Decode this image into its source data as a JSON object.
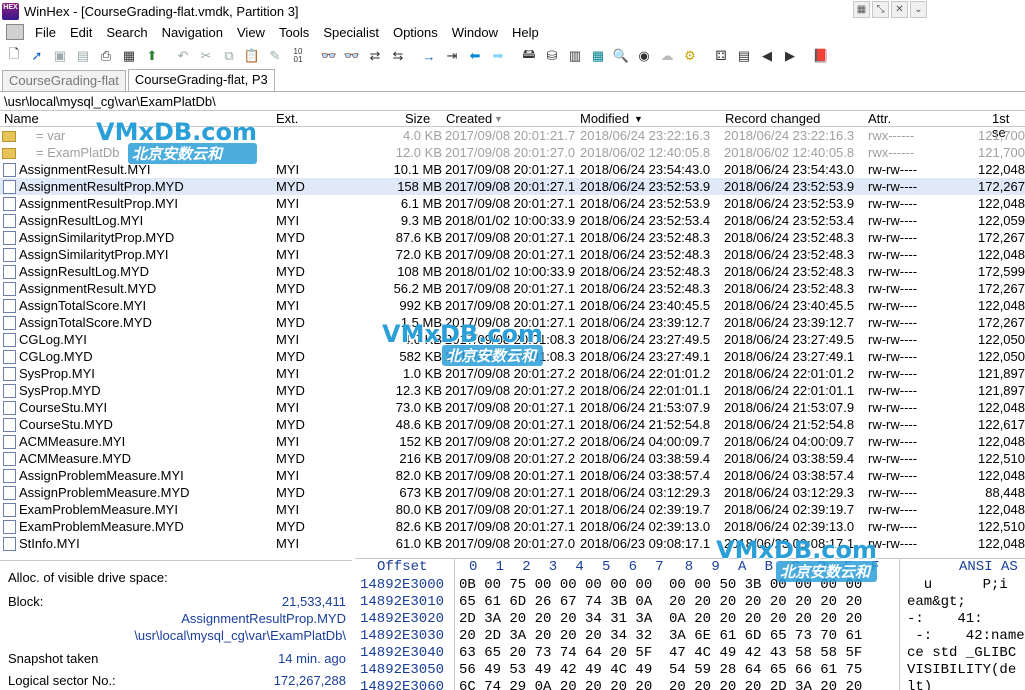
{
  "window": {
    "title": "WinHex - [CourseGrading-flat.vmdk, Partition 3]",
    "logo_text": "HEX"
  },
  "menu": [
    "File",
    "Edit",
    "Search",
    "Navigation",
    "View",
    "Tools",
    "Specialist",
    "Options",
    "Window",
    "Help"
  ],
  "tabs": [
    {
      "label": "CourseGrading-flat"
    },
    {
      "label": "CourseGrading-flat, P3"
    }
  ],
  "path": "\\usr\\local\\mysql_cg\\var\\ExamPlatDb\\",
  "columns": {
    "name": "Name",
    "ext": "Ext.",
    "size": "Size",
    "created": "Created",
    "modified": "Modified",
    "changed": "Record changed",
    "attr": "Attr.",
    "sector": "1st se"
  },
  "files": [
    {
      "name": "=     var",
      "ext": "",
      "size": "4.0 KB",
      "created": "2017/09/08   20:01:21.7",
      "modified": "2018/06/24   23:22:16.3",
      "changed": "2018/06/24   23:22:16.3",
      "attr": "rwx------",
      "sector": "121,700",
      "kind": "folder",
      "dim": true
    },
    {
      "name": "=     ExamPlatDb",
      "ext": "",
      "size": "12.0 KB",
      "created": "2017/09/08   20:01:27.0",
      "modified": "2018/06/02   12:40:05.8",
      "changed": "2018/06/02   12:40:05.8",
      "attr": "rwx------",
      "sector": "121,700",
      "kind": "folder",
      "dim": true
    },
    {
      "name": "AssignmentResult.MYI",
      "ext": "MYI",
      "size": "10.1 MB",
      "created": "2017/09/08   20:01:27.1",
      "modified": "2018/06/24   23:54:43.0",
      "changed": "2018/06/24   23:54:43.0",
      "attr": "rw-rw----",
      "sector": "122,048"
    },
    {
      "name": "AssignmentResultProp.MYD",
      "ext": "MYD",
      "size": "158 MB",
      "created": "2017/09/08   20:01:27.1",
      "modified": "2018/06/24   23:52:53.9",
      "changed": "2018/06/24   23:52:53.9",
      "attr": "rw-rw----",
      "sector": "172,267",
      "selected": true
    },
    {
      "name": "AssignmentResultProp.MYI",
      "ext": "MYI",
      "size": "6.1 MB",
      "created": "2017/09/08   20:01:27.1",
      "modified": "2018/06/24   23:52:53.9",
      "changed": "2018/06/24   23:52:53.9",
      "attr": "rw-rw----",
      "sector": "122,048"
    },
    {
      "name": "AssignResultLog.MYI",
      "ext": "MYI",
      "size": "9.3 MB",
      "created": "2018/01/02   10:00:33.9",
      "modified": "2018/06/24   23:52:53.4",
      "changed": "2018/06/24   23:52:53.4",
      "attr": "rw-rw----",
      "sector": "122,059"
    },
    {
      "name": "AssignSimilaritytProp.MYD",
      "ext": "MYD",
      "size": "87.6 KB",
      "created": "2017/09/08   20:01:27.1",
      "modified": "2018/06/24   23:52:48.3",
      "changed": "2018/06/24   23:52:48.3",
      "attr": "rw-rw----",
      "sector": "172,267"
    },
    {
      "name": "AssignSimilaritytProp.MYI",
      "ext": "MYI",
      "size": "72.0 KB",
      "created": "2017/09/08   20:01:27.1",
      "modified": "2018/06/24   23:52:48.3",
      "changed": "2018/06/24   23:52:48.3",
      "attr": "rw-rw----",
      "sector": "122,048"
    },
    {
      "name": "AssignResultLog.MYD",
      "ext": "MYD",
      "size": "108 MB",
      "created": "2018/01/02   10:00:33.9",
      "modified": "2018/06/24   23:52:48.3",
      "changed": "2018/06/24   23:52:48.3",
      "attr": "rw-rw----",
      "sector": "172,599"
    },
    {
      "name": "AssignmentResult.MYD",
      "ext": "MYD",
      "size": "56.2 MB",
      "created": "2017/09/08   20:01:27.1",
      "modified": "2018/06/24   23:52:48.3",
      "changed": "2018/06/24   23:52:48.3",
      "attr": "rw-rw----",
      "sector": "172,267"
    },
    {
      "name": "AssignTotalScore.MYI",
      "ext": "MYI",
      "size": "992 KB",
      "created": "2017/09/08   20:01:27.1",
      "modified": "2018/06/24   23:40:45.5",
      "changed": "2018/06/24   23:40:45.5",
      "attr": "rw-rw----",
      "sector": "122,048"
    },
    {
      "name": "AssignTotalScore.MYD",
      "ext": "MYD",
      "size": "1.5 MB",
      "created": "2017/09/08   20:01:27.1",
      "modified": "2018/06/24   23:39:12.7",
      "changed": "2018/06/24   23:39:12.7",
      "attr": "rw-rw----",
      "sector": "172,267"
    },
    {
      "name": "CGLog.MYI",
      "ext": "MYI",
      "size": "4.0 KB",
      "created": "2017/09/08   20:01:08.3",
      "modified": "2018/06/24   23:27:49.5",
      "changed": "2018/06/24   23:27:49.5",
      "attr": "rw-rw----",
      "sector": "122,050"
    },
    {
      "name": "CGLog.MYD",
      "ext": "MYD",
      "size": "582 KB",
      "created": "2017/09/08   20:01:08.3",
      "modified": "2018/06/24   23:27:49.1",
      "changed": "2018/06/24   23:27:49.1",
      "attr": "rw-rw----",
      "sector": "122,050"
    },
    {
      "name": "SysProp.MYI",
      "ext": "MYI",
      "size": "1.0 KB",
      "created": "2017/09/08   20:01:27.2",
      "modified": "2018/06/24   22:01:01.2",
      "changed": "2018/06/24   22:01:01.2",
      "attr": "rw-rw----",
      "sector": "121,897"
    },
    {
      "name": "SysProp.MYD",
      "ext": "MYD",
      "size": "12.3 KB",
      "created": "2017/09/08   20:01:27.2",
      "modified": "2018/06/24   22:01:01.1",
      "changed": "2018/06/24   22:01:01.1",
      "attr": "rw-rw----",
      "sector": "121,897"
    },
    {
      "name": "CourseStu.MYI",
      "ext": "MYI",
      "size": "73.0 KB",
      "created": "2017/09/08   20:01:27.1",
      "modified": "2018/06/24   21:53:07.9",
      "changed": "2018/06/24   21:53:07.9",
      "attr": "rw-rw----",
      "sector": "122,048"
    },
    {
      "name": "CourseStu.MYD",
      "ext": "MYD",
      "size": "48.6 KB",
      "created": "2017/09/08   20:01:27.1",
      "modified": "2018/06/24   21:52:54.8",
      "changed": "2018/06/24   21:52:54.8",
      "attr": "rw-rw----",
      "sector": "122,617"
    },
    {
      "name": "ACMMeasure.MYI",
      "ext": "MYI",
      "size": "152 KB",
      "created": "2017/09/08   20:01:27.2",
      "modified": "2018/06/24   04:00:09.7",
      "changed": "2018/06/24   04:00:09.7",
      "attr": "rw-rw----",
      "sector": "122,048"
    },
    {
      "name": "ACMMeasure.MYD",
      "ext": "MYD",
      "size": "216 KB",
      "created": "2017/09/08   20:01:27.2",
      "modified": "2018/06/24   03:38:59.4",
      "changed": "2018/06/24   03:38:59.4",
      "attr": "rw-rw----",
      "sector": "122,510"
    },
    {
      "name": "AssignProblemMeasure.MYI",
      "ext": "MYI",
      "size": "82.0 KB",
      "created": "2017/09/08   20:01:27.1",
      "modified": "2018/06/24   03:38:57.4",
      "changed": "2018/06/24   03:38:57.4",
      "attr": "rw-rw----",
      "sector": "122,048"
    },
    {
      "name": "AssignProblemMeasure.MYD",
      "ext": "MYD",
      "size": "673 KB",
      "created": "2017/09/08   20:01:27.1",
      "modified": "2018/06/24   03:12:29.3",
      "changed": "2018/06/24   03:12:29.3",
      "attr": "rw-rw----",
      "sector": "88,448"
    },
    {
      "name": "ExamProblemMeasure.MYI",
      "ext": "MYI",
      "size": "80.0 KB",
      "created": "2017/09/08   20:01:27.1",
      "modified": "2018/06/24   02:39:19.7",
      "changed": "2018/06/24   02:39:19.7",
      "attr": "rw-rw----",
      "sector": "122,048"
    },
    {
      "name": "ExamProblemMeasure.MYD",
      "ext": "MYD",
      "size": "82.6 KB",
      "created": "2017/09/08   20:01:27.1",
      "modified": "2018/06/24   02:39:13.0",
      "changed": "2018/06/24   02:39:13.0",
      "attr": "rw-rw----",
      "sector": "122,510"
    },
    {
      "name": "StInfo.MYI",
      "ext": "MYI",
      "size": "61.0 KB",
      "created": "2017/09/08   20:01:27.0",
      "modified": "2018/06/23   09:08:17.1",
      "changed": "2018/06/23   09:08:17.1",
      "attr": "rw-rw----",
      "sector": "122,048"
    }
  ],
  "info": {
    "alloc_label": "Alloc. of visible drive space:",
    "block_label": "Block:",
    "block_value": "21,533,411",
    "selected_file": "AssignmentResultProp.MYD",
    "selected_path": "\\usr\\local\\mysql_cg\\var\\ExamPlatDb\\",
    "snapshot_label": "Snapshot taken",
    "snapshot_value": "14 min. ago",
    "sector_label": "Logical sector No.:",
    "sector_value": "172,267,288"
  },
  "hex": {
    "offset_label": "Offset",
    "columns": [
      "0",
      "1",
      "2",
      "3",
      "4",
      "5",
      "6",
      "7",
      "8",
      "9",
      "A",
      "B",
      "C",
      "D",
      "E",
      "F"
    ],
    "ascii_label": "ANSI AS",
    "rows": [
      {
        "offset": "14892E3000",
        "bytes": "0B 00 75 00 00 00 00 00  00 00 50 3B 00 00 00 00",
        "ascii": "  u      P;i"
      },
      {
        "offset": "14892E3010",
        "bytes": "65 61 6D 26 67 74 3B 0A  20 20 20 20 20 20 20 20",
        "ascii": "eam&gt;"
      },
      {
        "offset": "14892E3020",
        "bytes": "2D 3A 20 20 20 34 31 3A  0A 20 20 20 20 20 20 20",
        "ascii": "-:    41:"
      },
      {
        "offset": "14892E3030",
        "bytes": "20 2D 3A 20 20 20 34 32  3A 6E 61 6D 65 73 70 61",
        "ascii": " -:    42:name"
      },
      {
        "offset": "14892E3040",
        "bytes": "63 65 20 73 74 64 20 5F  47 4C 49 42 43 58 58 5F",
        "ascii": "ce std _GLIBC"
      },
      {
        "offset": "14892E3050",
        "bytes": "56 49 53 49 42 49 4C 49  54 59 28 64 65 66 61 75",
        "ascii": "VISIBILITY(de"
      },
      {
        "offset": "14892E3060",
        "bytes": "6C 74 29 0A 20 20 20 20  20 20 20 20 2D 3A 20 20",
        "ascii": "lt)"
      }
    ]
  },
  "watermarks": [
    {
      "big": "VMxDB.com",
      "small": "北京安数云和"
    },
    {
      "big": "VMxDB.com",
      "small": "北京安数云和"
    },
    {
      "big": "VMxDB.com",
      "small": "北京安数云和"
    }
  ],
  "colors": {
    "selection": "#dfe9f7",
    "blue_text": "#1a3f9a",
    "watermark": "#2a9fd8"
  }
}
